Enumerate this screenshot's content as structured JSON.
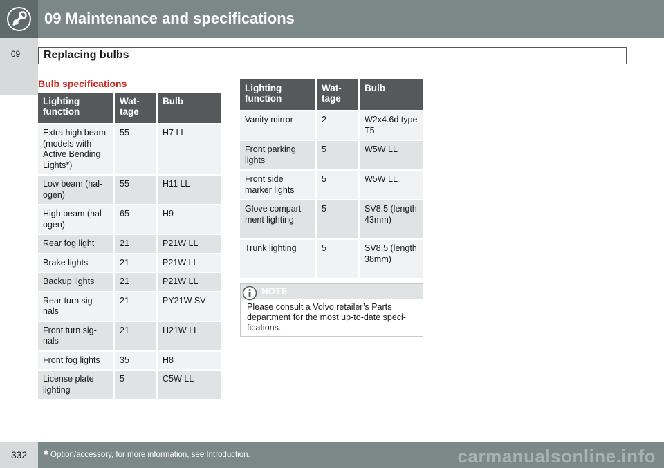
{
  "header": {
    "chapter_title": "09 Maintenance and specifications",
    "side_tab": "09"
  },
  "section": {
    "title": "Replacing bulbs"
  },
  "spec_heading": "Bulb specifications",
  "table_left": {
    "headers": [
      "Lighting function",
      "Wat-tage",
      "Bulb"
    ],
    "rows": [
      [
        "Extra high beam (models with Active Bending Lights*)",
        "55",
        "H7 LL"
      ],
      [
        "Low beam (hal-ogen)",
        "55",
        "H11 LL"
      ],
      [
        "High beam (hal-ogen)",
        "65",
        "H9"
      ],
      [
        "Rear fog light",
        "21",
        "P21W LL"
      ],
      [
        "Brake lights",
        "21",
        "P21W LL"
      ],
      [
        "Backup lights",
        "21",
        "P21W LL"
      ],
      [
        "Rear turn sig-nals",
        "21",
        "PY21W SV"
      ],
      [
        "Front turn sig-nals",
        "21",
        "H21W LL"
      ],
      [
        "Front fog lights",
        "35",
        "H8"
      ],
      [
        "License plate lighting",
        "5",
        "C5W LL"
      ]
    ]
  },
  "table_right": {
    "headers": [
      "Lighting function",
      "Wat-tage",
      "Bulb"
    ],
    "rows": [
      [
        "Vanity mirror",
        "2",
        "W2x4.6d type T5"
      ],
      [
        "Front parking lights",
        "5",
        "W5W LL"
      ],
      [
        "Front side marker lights",
        "5",
        "W5W LL"
      ],
      [
        "Glove compart-ment lighting",
        "5",
        "SV8.5 (length 43mm)"
      ],
      [
        "Trunk lighting",
        "5",
        "SV8.5 (length 38mm)"
      ]
    ]
  },
  "note": {
    "label": "NOTE",
    "text": "Please consult a Volvo retailer’s Parts department for the most up-to-date speci-fications."
  },
  "footer": {
    "page_number": "332",
    "star": "*",
    "footnote": "Option/accessory, for more information, see Introduction.",
    "watermark": "carmanualsonline.info"
  },
  "colors": {
    "header_bg": "#7c8787",
    "table_header_bg": "#56595b",
    "heading_red": "#cc2a1f"
  },
  "icons": {
    "chapter_icon": "wrench-gear-icon",
    "note_icon": "info-icon"
  }
}
